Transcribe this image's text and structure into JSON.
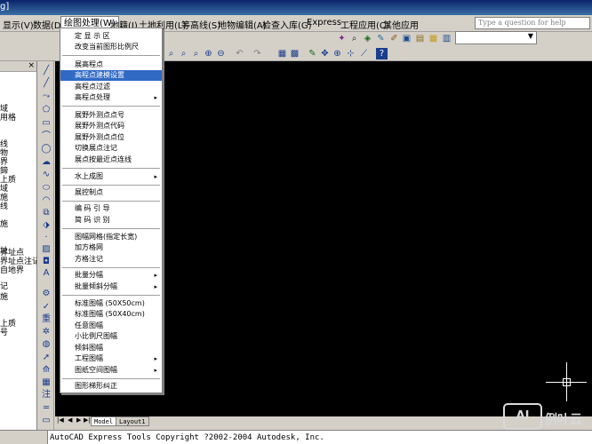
{
  "titlebar": {
    "text": "g]"
  },
  "menubar": {
    "items": [
      "显示(V)",
      "数据(D)",
      "绘图处理(W)",
      "地籍(J)",
      "土地利用(L)",
      "等高线(S)",
      "地物编辑(A)",
      "检查入库(G)",
      "Express",
      "工程应用(C)",
      "其他应用"
    ],
    "help_placeholder": "Type a question for help"
  },
  "toolbar": {
    "combo_value": "",
    "combo_icon": "chevron-down-icon"
  },
  "left_panel": {
    "close_label": "×",
    "items": [
      "域",
      "用格",
      "线",
      "物",
      "界",
      "鍗",
      "上质",
      "域",
      "施",
      "线",
      "施",
      "",
      "址",
      "界址点",
      "界址点注记",
      "自地界",
      "记",
      "施",
      "",
      "上质",
      "号"
    ]
  },
  "menu": {
    "active": "绘图处理(W)",
    "items": [
      {
        "label": "定 显 示 区",
        "submenu": false
      },
      {
        "label": "改变当前图形比例尺",
        "submenu": false
      },
      {
        "label": "展高程点",
        "submenu": false
      },
      {
        "label": "高程点建模设置",
        "submenu": false,
        "selected": true
      },
      {
        "label": "高程点过滤",
        "submenu": false
      },
      {
        "label": "高程点处理",
        "submenu": true
      },
      {
        "label": "展野外测点点号",
        "submenu": false
      },
      {
        "label": "展野外测点代码",
        "submenu": false
      },
      {
        "label": "展野外测点点位",
        "submenu": false
      },
      {
        "label": "切换展点注记",
        "submenu": false
      },
      {
        "label": "展点按最近点连线",
        "submenu": false
      },
      {
        "label": "水上成图",
        "submenu": true
      },
      {
        "label": "展控制点",
        "submenu": false
      },
      {
        "label": "编 码 引 导",
        "submenu": false
      },
      {
        "label": "简 码 识 别",
        "submenu": false
      },
      {
        "label": "图幅网格(指定长宽)",
        "submenu": false
      },
      {
        "label": "加方格网",
        "submenu": false
      },
      {
        "label": "方格注记",
        "submenu": false
      },
      {
        "label": "批量分幅",
        "submenu": true
      },
      {
        "label": "批量倾斜分幅",
        "submenu": true
      },
      {
        "label": "标准图幅 (50X50cm)",
        "submenu": false
      },
      {
        "label": "标准图幅 (50X40cm)",
        "submenu": false
      },
      {
        "label": "任意图幅",
        "submenu": false
      },
      {
        "label": "小比例尺图幅",
        "submenu": false
      },
      {
        "label": "倾斜图幅",
        "submenu": false
      },
      {
        "label": "工程图幅",
        "submenu": true
      },
      {
        "label": "图纸空间图幅",
        "submenu": true
      },
      {
        "label": "图形梯形纠正",
        "submenu": false
      }
    ],
    "submenu_icon": "▸"
  },
  "tabs": {
    "model": "Model",
    "layout": "Layout1"
  },
  "command": {
    "text": "AutoCAD Express Tools Copyright ?2002-2004 Autodesk, Inc."
  },
  "watermark": {
    "logo": "AI",
    "text": "例叶云"
  },
  "colors": {
    "canvas": "#000000",
    "menu_selected": "#316ac5",
    "chrome": "#d4d0c8"
  }
}
